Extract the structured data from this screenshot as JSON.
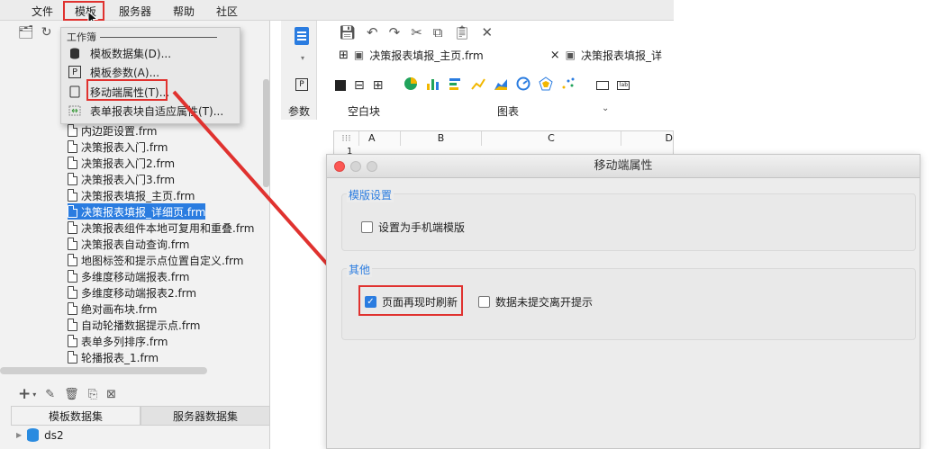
{
  "menubar": {
    "items": [
      "文件",
      "模板",
      "服务器",
      "帮助",
      "社区"
    ],
    "active_index": 1
  },
  "dropdown": {
    "header": "工作簿",
    "items": [
      {
        "label": "模板数据集(D)...",
        "icon": "database-icon"
      },
      {
        "label": "模板参数(A)...",
        "icon": "parameter-icon"
      },
      {
        "label": "移动端属性(T)...",
        "icon": "mobile-icon"
      },
      {
        "label": "表单报表块自适应属性(T)...",
        "icon": "adaptive-icon"
      }
    ],
    "highlighted_index": 2
  },
  "tree": {
    "items": [
      "内边距设置.frm",
      "决策报表入门.frm",
      "决策报表入门2.frm",
      "决策报表入门3.frm",
      "决策报表填报_主页.frm",
      "决策报表填报_详细页.frm",
      "决策报表组件本地可复用和重叠.frm",
      "决策报表自动查询.frm",
      "地图标签和提示点位置自定义.frm",
      "多维度移动端报表.frm",
      "多维度移动端报表2.frm",
      "绝对画布块.frm",
      "自动轮播数据提示点.frm",
      "表单多列排序.frm",
      "轮播报表_1.frm"
    ],
    "selected_index": 5
  },
  "datasource": {
    "tabs": [
      "模板数据集",
      "服务器数据集"
    ],
    "active_tab": 0,
    "items": [
      "ds2"
    ]
  },
  "editor": {
    "tabs": [
      "决策报表填报_主页.frm",
      "决策报表填报_详"
    ],
    "close_glyph": "×",
    "ribbon_labels": [
      "参数",
      "空白块",
      "图表"
    ],
    "param_glyph": "P",
    "sheet_columns": [
      "A",
      "B",
      "C",
      "D"
    ],
    "sheet_row_number": "1"
  },
  "dialog": {
    "title": "移动端属性",
    "sections": [
      {
        "title": "模版设置",
        "options": [
          {
            "label": "设置为手机端模版",
            "checked": false
          }
        ]
      },
      {
        "title": "其他",
        "options": [
          {
            "label": "页面再现时刷新",
            "checked": true
          },
          {
            "label": "数据未提交离开提示",
            "checked": false
          }
        ]
      }
    ]
  },
  "colors": {
    "accent": "#2a7ce0",
    "highlight": "#e0322f",
    "chart_yellow": "#f2b700",
    "chart_green": "#21a35b"
  }
}
